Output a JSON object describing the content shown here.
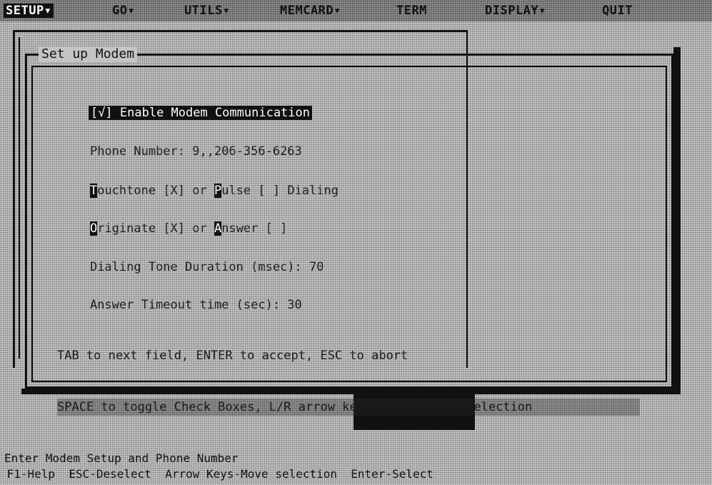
{
  "menubar": {
    "items": [
      "SETUP▾",
      "GO▾",
      "UTILS▾",
      "MEMCARD▾",
      "TERM",
      "DISPLAY▾",
      "QUIT"
    ]
  },
  "dialog": {
    "title": "Set up Modem",
    "enable_checkbox": "[√] Enable Modem Communication",
    "phone_label": "Phone Number: ",
    "phone_value": "9,,206-356-6263",
    "dial_hot1": "T",
    "dial_part1": "ouchtone [X] or ",
    "dial_hot2": "P",
    "dial_part2": "ulse [ ] Dialing",
    "orig_hot1": "O",
    "orig_part1": "riginate [X] or ",
    "orig_hot2": "A",
    "orig_part2": "nswer [ ]",
    "dial_tone_label": "Dialing Tone Duration (msec): ",
    "dial_tone_value": "70",
    "answer_timeout_label": "Answer Timeout time (sec): ",
    "answer_timeout_value": "30",
    "help_line1": "TAB to next field, ENTER to accept, ESC to abort",
    "help_line2": "SPACE to toggle Check Boxes, L/R arrow keys to change X selection"
  },
  "status": {
    "line1": "Enter Modem Setup and Phone Number",
    "line2": " F1-Help  ESC-Deselect  Arrow Keys-Move selection  Enter-Select"
  }
}
